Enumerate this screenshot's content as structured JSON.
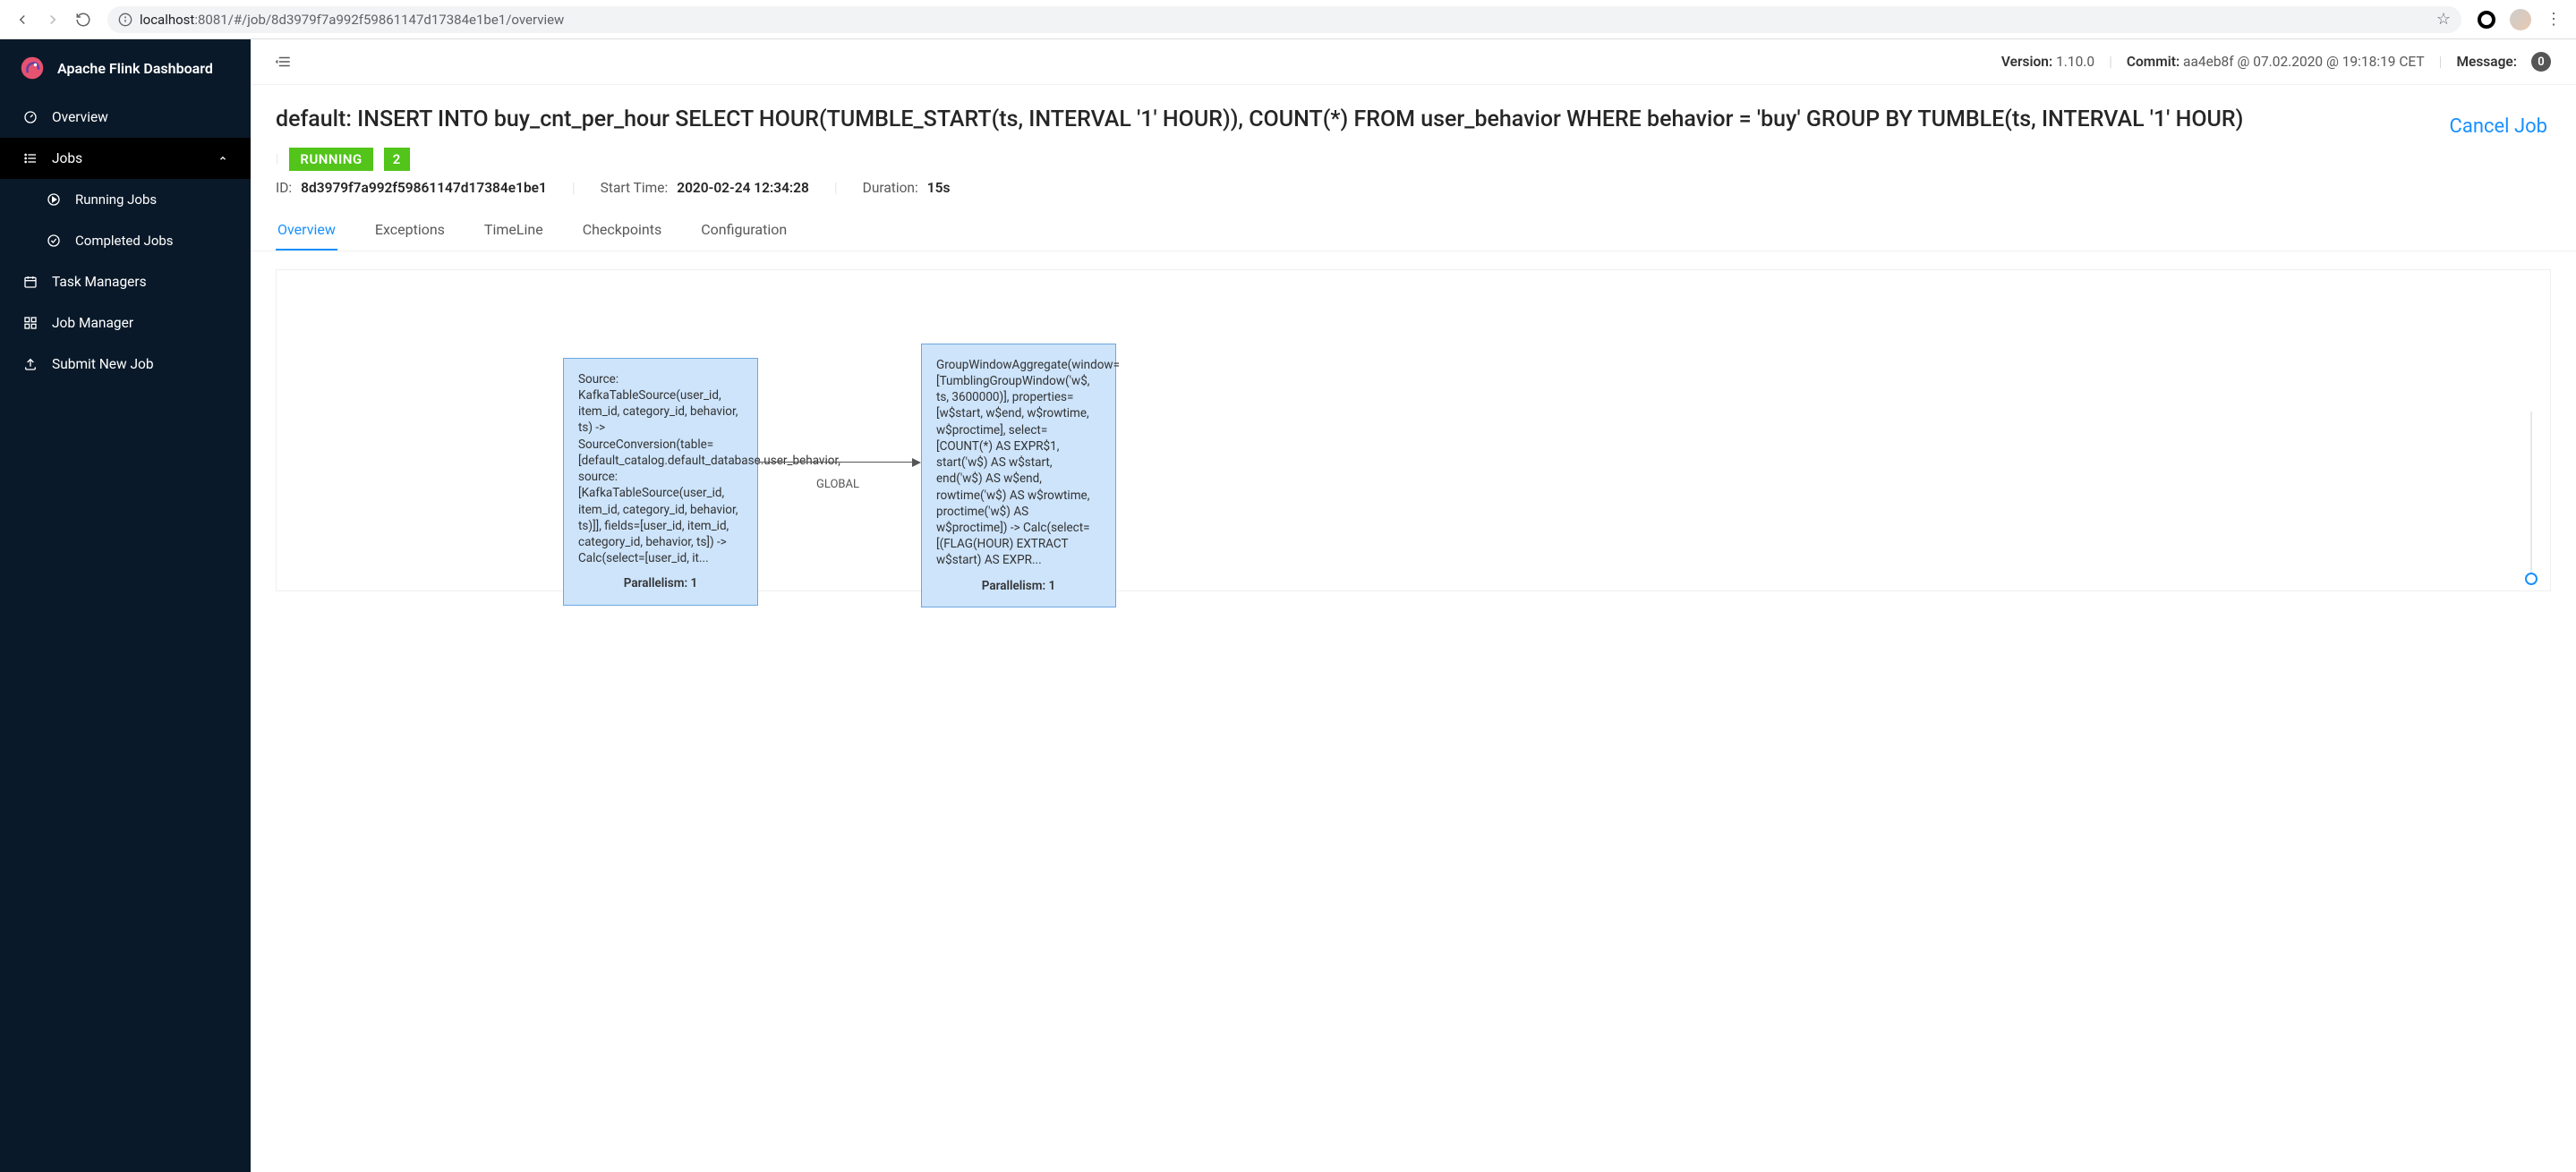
{
  "browser": {
    "url_host": "localhost",
    "url_port": ":8081",
    "url_path": "/#/job/8d3979f7a992f59861147d17384e1be1/overview"
  },
  "sidebar": {
    "brand": "Apache Flink Dashboard",
    "items": [
      {
        "label": "Overview",
        "icon": "dashboard-icon"
      },
      {
        "label": "Jobs",
        "icon": "list-icon",
        "expanded": true
      },
      {
        "label": "Running Jobs",
        "icon": "play-circle-icon",
        "sub": true
      },
      {
        "label": "Completed Jobs",
        "icon": "check-circle-icon",
        "sub": true
      },
      {
        "label": "Task Managers",
        "icon": "calendar-icon"
      },
      {
        "label": "Job Manager",
        "icon": "grid-icon"
      },
      {
        "label": "Submit New Job",
        "icon": "upload-icon"
      }
    ]
  },
  "topbar": {
    "version_label": "Version:",
    "version_value": "1.10.0",
    "commit_label": "Commit:",
    "commit_value": "aa4eb8f @ 07.02.2020 @ 19:18:19 CET",
    "message_label": "Message:",
    "message_count": "0"
  },
  "job": {
    "title": "default: INSERT INTO buy_cnt_per_hour SELECT HOUR(TUMBLE_START(ts, INTERVAL '1' HOUR)), COUNT(*) FROM user_behavior WHERE behavior = 'buy' GROUP BY TUMBLE(ts, INTERVAL '1' HOUR)",
    "cancel_label": "Cancel Job",
    "status": "RUNNING",
    "task_count": "2",
    "id_label": "ID:",
    "id_value": "8d3979f7a992f59861147d17384e1be1",
    "start_label": "Start Time:",
    "start_value": "2020-02-24 12:34:28",
    "duration_label": "Duration:",
    "duration_value": "15s"
  },
  "tabs": [
    {
      "label": "Overview",
      "active": true
    },
    {
      "label": "Exceptions"
    },
    {
      "label": "TimeLine"
    },
    {
      "label": "Checkpoints"
    },
    {
      "label": "Configuration"
    }
  ],
  "graph": {
    "edge_label": "GLOBAL",
    "parallelism_label": "Parallelism: 1",
    "nodes": [
      {
        "text": "Source: KafkaTableSource(user_id, item_id, category_id, behavior, ts) -> SourceConversion(table=[default_catalog.default_database.user_behavior, source: [KafkaTableSource(user_id, item_id, category_id, behavior, ts)]], fields=[user_id, item_id, category_id, behavior, ts]) -> Calc(select=[user_id, it..."
      },
      {
        "text": "GroupWindowAggregate(window=[TumblingGroupWindow('w$, ts, 3600000)], properties=[w$start, w$end, w$rowtime, w$proctime], select=[COUNT(*) AS EXPR$1, start('w$) AS w$start, end('w$) AS w$end, rowtime('w$) AS w$rowtime, proctime('w$) AS w$proctime]) -> Calc(select=[(FLAG(HOUR) EXTRACT w$start) AS EXPR..."
      }
    ]
  }
}
